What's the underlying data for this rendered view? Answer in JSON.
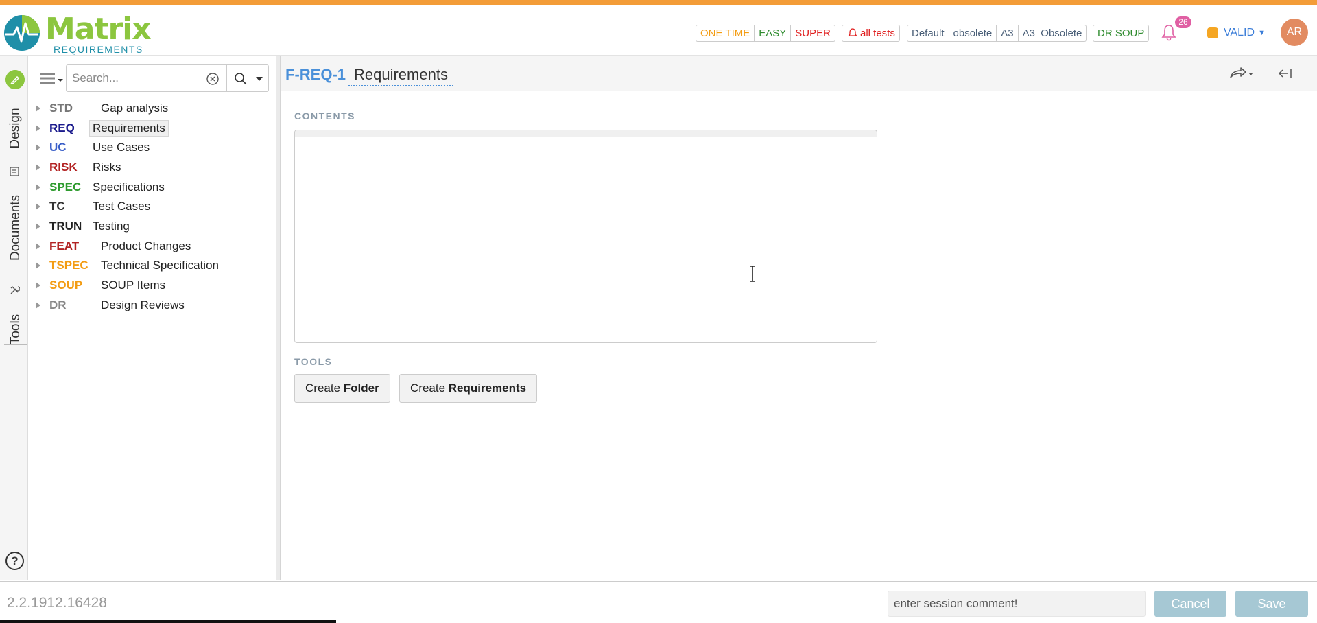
{
  "header": {
    "brand_name": "Matrix",
    "brand_sub": "REQUIREMENTS",
    "tag_group_1": [
      {
        "label": "ONE TIME",
        "color": "#f39c12"
      },
      {
        "label": "EASY",
        "color": "#2e8b2e"
      },
      {
        "label": "SUPER",
        "color": "#e02020"
      }
    ],
    "all_tests": {
      "label": "all tests",
      "color": "#e02020"
    },
    "tag_group_2": [
      {
        "label": "Default",
        "color": "#4a5f78"
      },
      {
        "label": "obsolete",
        "color": "#4a5f78"
      },
      {
        "label": "A3",
        "color": "#4a5f78"
      },
      {
        "label": "A3_Obsolete",
        "color": "#4a5f78"
      }
    ],
    "dr_soup": {
      "label": "DR SOUP",
      "color": "#2e8b2e"
    },
    "notification_count": "26",
    "status_label": "VALID",
    "avatar_initials": "AR"
  },
  "rail": {
    "tabs": [
      "Design",
      "Documents",
      "Tools"
    ],
    "help_label": "?"
  },
  "tree": {
    "search_placeholder": "Search...",
    "items": [
      {
        "code": "STD",
        "label": "Gap analysis",
        "color": "#777777"
      },
      {
        "code": "REQ",
        "label": "Requirements",
        "color": "#1a1a8c"
      },
      {
        "code": "UC",
        "label": "Use Cases",
        "color": "#3a5fc8"
      },
      {
        "code": "RISK",
        "label": "Risks",
        "color": "#b22222"
      },
      {
        "code": "SPEC",
        "label": "Specifications",
        "color": "#2e9b2e"
      },
      {
        "code": "TC",
        "label": "Test Cases",
        "color": "#333333"
      },
      {
        "code": "TRUN",
        "label": "Testing",
        "color": "#222222"
      },
      {
        "code": "FEAT",
        "label": "Product Changes",
        "color": "#b22222"
      },
      {
        "code": "TSPEC",
        "label": "Technical Specification",
        "color": "#f39c12"
      },
      {
        "code": "SOUP",
        "label": "SOUP Items",
        "color": "#f39c12"
      },
      {
        "code": "DR",
        "label": "Design Reviews",
        "color": "#888888"
      }
    ]
  },
  "main": {
    "item_id": "F-REQ-1",
    "item_title": "Requirements",
    "contents_label": "CONTENTS",
    "tools_label": "TOOLS",
    "create_folder": {
      "prefix": "Create",
      "bold": "Folder"
    },
    "create_requirements": {
      "prefix": "Create",
      "bold": "Requirements"
    }
  },
  "footer": {
    "version": "2.2.1912.16428",
    "session_placeholder": "enter session comment!",
    "cancel_label": "Cancel",
    "save_label": "Save"
  }
}
